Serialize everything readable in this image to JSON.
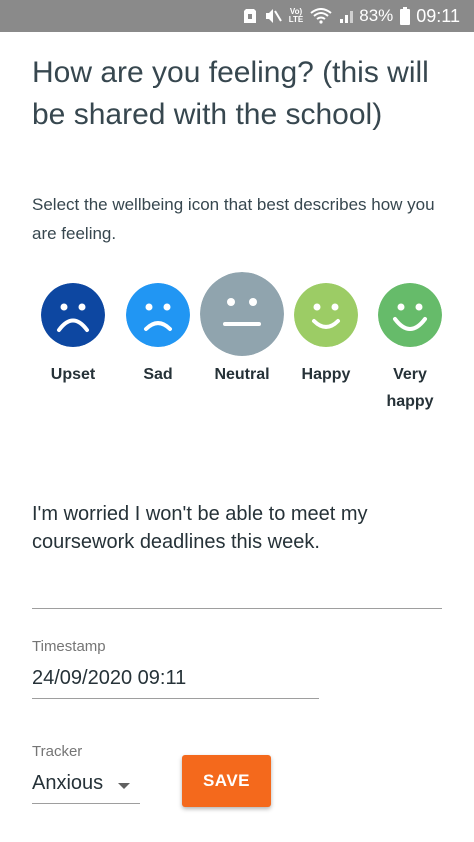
{
  "status_bar": {
    "volte_top": "Vo)",
    "volte_bottom": "LTE",
    "battery_pct": "83%",
    "time": "09:11"
  },
  "page": {
    "title": "How are you feeling? (this will be shared with the school)",
    "subtitle": "Select the wellbeing icon that best describes how you are feeling."
  },
  "moods": [
    {
      "label": "Upset",
      "color": "#0d47a1",
      "face": "upset-face-icon",
      "selected": false
    },
    {
      "label": "Sad",
      "color": "#2196f3",
      "face": "sad-face-icon",
      "selected": false
    },
    {
      "label": "Neutral",
      "color": "#90a4ae",
      "face": "neutral-face-icon",
      "selected": true
    },
    {
      "label": "Happy",
      "color": "#9ccc65",
      "face": "happy-face-icon",
      "selected": false
    },
    {
      "label": "Very happy",
      "color": "#66bb6a",
      "face": "very-happy-face-icon",
      "selected": false
    }
  ],
  "note": {
    "value": "I'm worried I won't be able to meet my coursework deadlines this week."
  },
  "timestamp": {
    "label": "Timestamp",
    "value": "24/09/2020 09:11"
  },
  "tracker": {
    "label": "Tracker",
    "value": "Anxious"
  },
  "save": {
    "label": "SAVE",
    "color": "#f4691c"
  }
}
